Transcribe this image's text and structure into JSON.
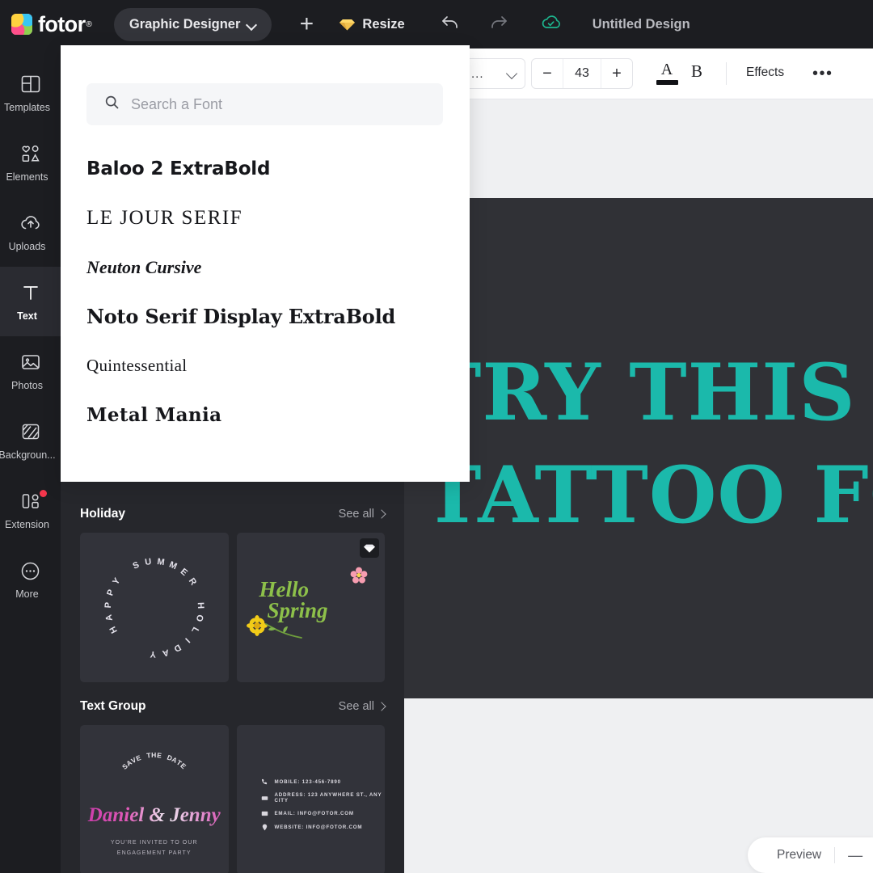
{
  "app": {
    "brand": "fotor",
    "brand_mark": "logo-icon",
    "registered": "®"
  },
  "header": {
    "mode_label": "Graphic Designer",
    "mode_chevron": "chevron-down-icon",
    "add_label": "+",
    "resize_label": "Resize",
    "resize_icon": "gem-icon",
    "undo_icon": "undo-arrow-icon",
    "redo_icon": "redo-arrow-icon",
    "save_status_icon": "cloud-check-icon",
    "document_title": "Untitled Design"
  },
  "sidebar": {
    "items": [
      {
        "label": "Templates",
        "icon": "templates-icon",
        "active": false,
        "badge": false
      },
      {
        "label": "Elements",
        "icon": "elements-icon",
        "active": false,
        "badge": false
      },
      {
        "label": "Uploads",
        "icon": "upload-cloud-icon",
        "active": false,
        "badge": false
      },
      {
        "label": "Text",
        "icon": "text-t-icon",
        "active": true,
        "badge": false
      },
      {
        "label": "Photos",
        "icon": "photo-icon",
        "active": false,
        "badge": false
      },
      {
        "label": "Backgroun...",
        "icon": "background-icon",
        "active": false,
        "badge": false
      },
      {
        "label": "Extension",
        "icon": "extension-icon",
        "active": false,
        "badge": true
      },
      {
        "label": "More",
        "icon": "more-dots-icon",
        "active": false,
        "badge": false
      }
    ]
  },
  "font_dropdown": {
    "search": {
      "placeholder": "Search a Font",
      "value": "",
      "icon": "search-icon"
    },
    "fonts": [
      {
        "name": "Baloo 2 ExtraBold",
        "style": "f-baloo"
      },
      {
        "name": "LE JOUR SERIF",
        "style": "f-lejour"
      },
      {
        "name": "Neuton Cursive",
        "style": "f-neuton"
      },
      {
        "name": "Noto Serif Display ExtraBold",
        "style": "f-noto"
      },
      {
        "name": "Quintessential",
        "style": "f-quint"
      },
      {
        "name": "Metal Mania",
        "style": "f-metal"
      }
    ]
  },
  "text_toolbar": {
    "font_name_truncated": "...",
    "font_chevron": "chevron-down-icon",
    "decrease_label": "−",
    "font_size": "43",
    "increase_label": "+",
    "text_color_label": "A",
    "text_color_swatch": "#111216",
    "bold_label": "B",
    "effects_label": "Effects",
    "more_label": "•••"
  },
  "panel": {
    "sections": [
      {
        "title": "Holiday",
        "see_all": "See all",
        "cards": [
          {
            "name": "happy-summer-holiday-card",
            "kind": "circle-text",
            "text": "HAPPY SUMMER HOLIDAY",
            "pro": false
          },
          {
            "name": "hello-spring-card",
            "kind": "hello-spring",
            "line1": "Hello",
            "line2": "Spring",
            "pro": true,
            "pro_icon": "gem-icon"
          }
        ]
      },
      {
        "title": "Text Group",
        "see_all": "See all",
        "cards": [
          {
            "name": "save-the-date-card",
            "kind": "save-the-date",
            "arc_text": "SAVE THE DATE",
            "names": "Daniel & Jenny",
            "sub_line1": "YOU'RE INVITED TO OUR",
            "sub_line2": "ENGAGEMENT PARTY",
            "pro": false
          },
          {
            "name": "contact-info-card",
            "kind": "contact-list",
            "rows": [
              {
                "icon": "phone-icon",
                "text": "MOBILE: 123-456-7890"
              },
              {
                "icon": "location-icon",
                "text": "ADDRESS: 123 ANYWHERE ST., ANY CITY"
              },
              {
                "icon": "mail-icon",
                "text": "EMAIL: INFO@FOTOR.COM"
              },
              {
                "icon": "globe-icon",
                "text": "WEBSITE: INFO@FOTOR.COM"
              }
            ],
            "pro": false
          }
        ]
      }
    ]
  },
  "canvas": {
    "text_line1": "TRY THIS",
    "text_line2": "TATTOO FONT",
    "text_color": "#1bb9ab",
    "background_color": "#303136"
  },
  "bottom_bar": {
    "preview_label": "Preview",
    "collapse_label": "—"
  },
  "colors": {
    "chrome_dark": "#1c1d21",
    "panel_dark": "#26272c",
    "card_dark": "#32333a",
    "accent_teal": "#1bb9ab",
    "badge_red": "#f4364c"
  }
}
